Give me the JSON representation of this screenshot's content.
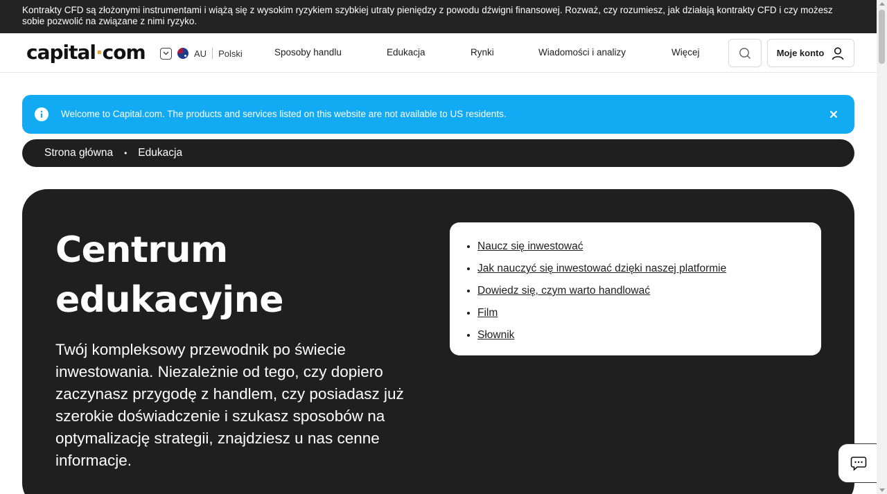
{
  "risk_warning": "Kontrakty CFD są złożonymi instrumentami i wiążą się z wysokim ryzykiem szybkiej utraty pieniędzy z powodu dźwigni finansowej. Rozważ, czy rozumiesz, jak działają kontrakty CFD i czy możesz sobie pozwolić na związane z nimi ryzyko.",
  "header": {
    "logo_left": "capital",
    "logo_dot": "·",
    "logo_right": "com",
    "region": "AU",
    "language": "Polski",
    "nav": [
      "Sposoby handlu",
      "Edukacja",
      "Rynki",
      "Wiadomości i analizy",
      "Więcej"
    ],
    "account_label": "Moje konto"
  },
  "notice": {
    "message": "Welcome to Capital.com. The products and services listed on this website are not available to US residents."
  },
  "breadcrumb": {
    "items": [
      "Strona główna",
      "Edukacja"
    ],
    "separator": "•"
  },
  "hero": {
    "title_line1": "Centrum",
    "title_line2": "edukacyjne",
    "description": "Twój kompleksowy przewodnik po świecie inwestowania. Niezależnie od tego, czy dopiero zaczynasz przygodę z handlem, czy posiadasz już szerokie doświadczenie i szukasz sposobów na optymalizację strategii, znajdziesz u nas cenne informacje.",
    "links": [
      "Naucz się inwestować",
      "Jak nauczyć się inwestować dzięki naszej platformie",
      "Dowiedz się, czym warto handlować",
      "Film",
      "Słownik"
    ]
  },
  "colors": {
    "notice_bg": "#12aaf2",
    "dark_bg": "#1f1f1f",
    "logo_dot": "#e9a13b"
  },
  "icons": {
    "search": "search-icon",
    "account": "user-icon",
    "info": "info-icon",
    "close": "close-icon",
    "chat": "chat-icon",
    "locale_toggle": "chevron-down-icon"
  }
}
